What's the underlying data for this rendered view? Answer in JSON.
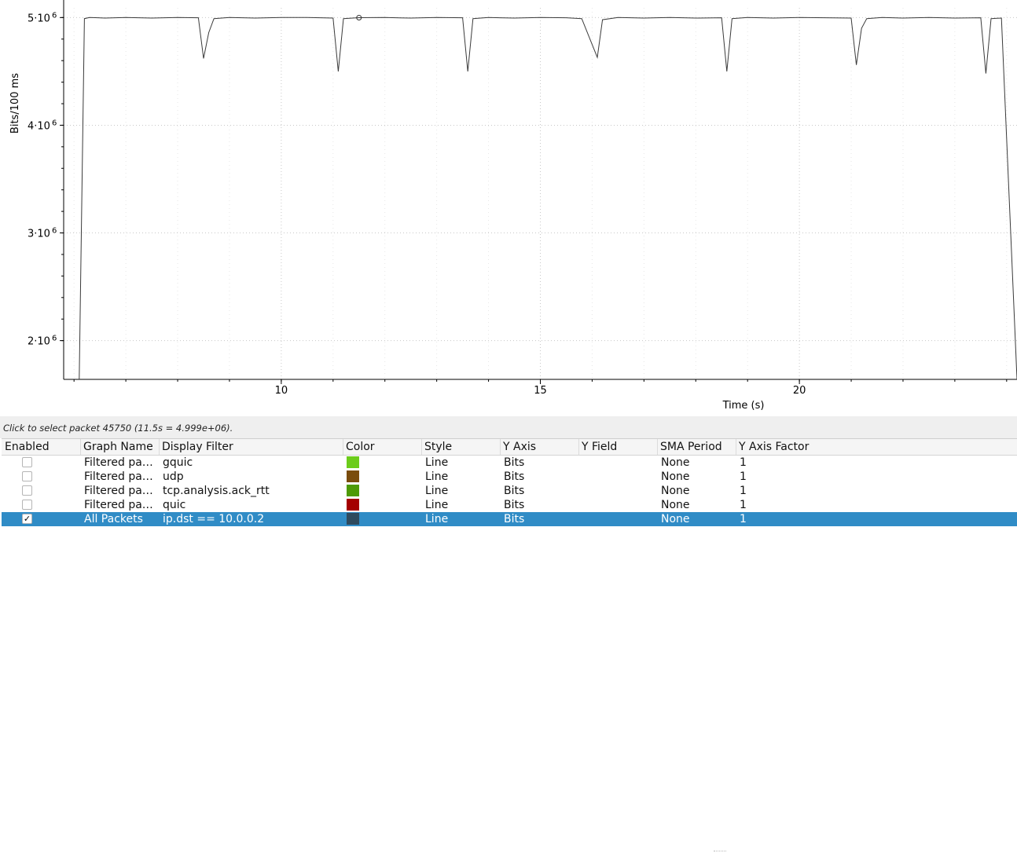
{
  "plot": {
    "y_axis_title": "Bits/100 ms",
    "x_axis_title": "Time (s)",
    "y_ticks": [
      {
        "value": 5000000,
        "label": "5·10",
        "exp": "6"
      },
      {
        "value": 4000000,
        "label": "4·10",
        "exp": "6"
      },
      {
        "value": 3000000,
        "label": "3·10",
        "exp": "6"
      },
      {
        "value": 2000000,
        "label": "2·10",
        "exp": "6"
      }
    ],
    "x_ticks": [
      {
        "value": 10,
        "label": "10"
      },
      {
        "value": 15,
        "label": "15"
      },
      {
        "value": 20,
        "label": "20"
      }
    ],
    "line_color": "#3a3a3a",
    "grid": true,
    "selected_point": {
      "x": 11.5,
      "y": 4999000
    }
  },
  "chart_data": {
    "type": "line",
    "xlabel": "Time (s)",
    "ylabel": "Bits/100 ms",
    "xlim": [
      5.8,
      24.2
    ],
    "ylim": [
      1640000,
      5090000
    ],
    "x_ticks": [
      10,
      15,
      20
    ],
    "y_ticks": [
      2000000,
      3000000,
      4000000,
      5000000
    ],
    "grid": true,
    "series": [
      {
        "color": "#3a3a3a",
        "points": [
          [
            6.1,
            1640000
          ],
          [
            6.2,
            4990000
          ],
          [
            6.3,
            5000000
          ],
          [
            6.6,
            4995000
          ],
          [
            7.0,
            5000000
          ],
          [
            7.5,
            4995000
          ],
          [
            8.0,
            5000000
          ],
          [
            8.4,
            4998000
          ],
          [
            8.5,
            4620000
          ],
          [
            8.6,
            4860000
          ],
          [
            8.7,
            4990000
          ],
          [
            9.0,
            5000000
          ],
          [
            9.5,
            4995000
          ],
          [
            10.0,
            5000000
          ],
          [
            10.5,
            5000000
          ],
          [
            11.0,
            4995000
          ],
          [
            11.1,
            4500000
          ],
          [
            11.2,
            4990000
          ],
          [
            11.5,
            4999000
          ],
          [
            12.0,
            5000000
          ],
          [
            12.5,
            4995000
          ],
          [
            13.0,
            5000000
          ],
          [
            13.5,
            4998000
          ],
          [
            13.6,
            4500000
          ],
          [
            13.7,
            4990000
          ],
          [
            14.0,
            5000000
          ],
          [
            14.5,
            4995000
          ],
          [
            15.0,
            5000000
          ],
          [
            15.5,
            4998000
          ],
          [
            15.8,
            4990000
          ],
          [
            16.1,
            4630000
          ],
          [
            16.2,
            4980000
          ],
          [
            16.5,
            5000000
          ],
          [
            17.0,
            4995000
          ],
          [
            17.5,
            5000000
          ],
          [
            18.0,
            4995000
          ],
          [
            18.5,
            4998000
          ],
          [
            18.6,
            4500000
          ],
          [
            18.7,
            4990000
          ],
          [
            19.0,
            5000000
          ],
          [
            19.5,
            4995000
          ],
          [
            20.0,
            5000000
          ],
          [
            20.5,
            4998000
          ],
          [
            21.0,
            4995000
          ],
          [
            21.1,
            4560000
          ],
          [
            21.2,
            4900000
          ],
          [
            21.3,
            4990000
          ],
          [
            21.6,
            5000000
          ],
          [
            22.0,
            4995000
          ],
          [
            22.5,
            5000000
          ],
          [
            23.0,
            4995000
          ],
          [
            23.5,
            4998000
          ],
          [
            23.6,
            4480000
          ],
          [
            23.7,
            4990000
          ],
          [
            23.9,
            4995000
          ],
          [
            24.2,
            1640000
          ]
        ]
      }
    ]
  },
  "status": {
    "text": "Click to select packet 45750 (11.5s = 4.999e+06)."
  },
  "table": {
    "columns": [
      "Enabled",
      "Graph Name",
      "Display Filter",
      "Color",
      "Style",
      "Y Axis",
      "Y Field",
      "SMA Period",
      "Y Axis Factor"
    ],
    "rows": [
      {
        "enabled": false,
        "enabled_mark": "",
        "name": "Filtered pa…",
        "filter": "gquic",
        "color": "#6ccc1b",
        "style": "Line",
        "y_axis": "Bits",
        "y_field": "",
        "sma": "None",
        "factor": "1"
      },
      {
        "enabled": false,
        "enabled_mark": "",
        "name": "Filtered pa…",
        "filter": "udp",
        "color": "#7a4c0c",
        "style": "Line",
        "y_axis": "Bits",
        "y_field": "",
        "sma": "None",
        "factor": "1"
      },
      {
        "enabled": false,
        "enabled_mark": "",
        "name": "Filtered pa…",
        "filter": "tcp.analysis.ack_rtt",
        "color": "#4e9a06",
        "style": "Line",
        "y_axis": "Bits",
        "y_field": "",
        "sma": "None",
        "factor": "1"
      },
      {
        "enabled": false,
        "enabled_mark": "",
        "name": "Filtered pa…",
        "filter": "quic",
        "color": "#a40000",
        "style": "Line",
        "y_axis": "Bits",
        "y_field": "",
        "sma": "None",
        "factor": "1"
      },
      {
        "enabled": true,
        "enabled_mark": "✓",
        "name": "All Packets",
        "filter": "ip.dst == 10.0.0.2",
        "color": "#2e4a5e",
        "style": "Line",
        "y_axis": "Bits",
        "y_field": "",
        "sma": "None",
        "factor": "1"
      }
    ]
  }
}
